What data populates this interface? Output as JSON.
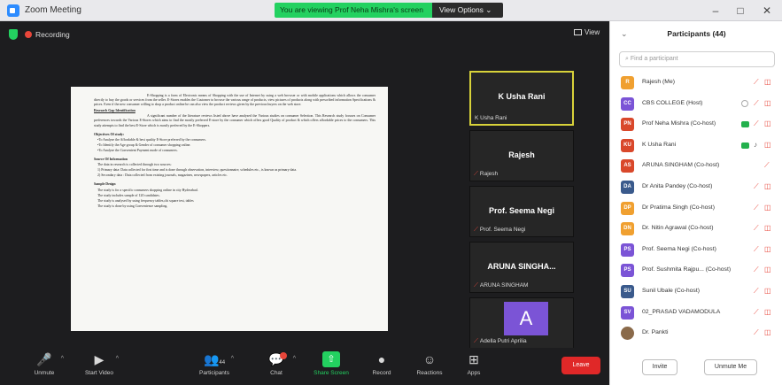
{
  "window": {
    "title": "Zoom Meeting",
    "banner": "You are viewing Prof Neha Mishra's screen",
    "view_options": "View Options ⌄"
  },
  "meeting": {
    "recording_label": "Recording",
    "view_label": "View"
  },
  "document": {
    "intro": "E-Shopping is a form of Electronic means of Shopping with the use of Internet by using a web browser or with mobile applications which allows the consumer directly to buy the goods or services from the seller. E-Stores enables the Customer to browse the various range of products, view pictures of products along with prescribed information Specifications & prices. Even if the new consumer willing to shop a product online he can also view the product reviews given by the previous buyers on the web store.",
    "gap_heading": "Research Gap Identification",
    "gap_text": "A significant number of the literature reviews listed above have analysed the Various studies on consumer Selection. This Research study focuses on Consumer preferences towards the Various E-Stores which aims to find the mostly preferred E-store by the consumer which offers good Quality of product & which offers affordable prices to the consumers. This study attempts to find the best E-Store which is mostly preferred by the E-Shoppers.",
    "objectives_heading": "Objectives Of study:",
    "objectives": [
      "•To Analyze the Affordable & best quality E-Store preferred by the consumers.",
      "•To Identify the Age group & Gender of consumer shopping online.",
      "•To Analyze the Convenient Payment mode of consumers."
    ],
    "source_heading": "Source Of Information",
    "source_intro": "The data in research is collected through two sources:",
    "sources": [
      "1) Primary data: Data collected for first time and is done through observation, interview, questionnaire, schedules etc., is known as primary data.",
      "2) Secondary data : Data collected from existing journals, magazines, newspapers, articles etc."
    ],
    "sample_heading": "Sample Design",
    "sample": [
      "The study is for a specific consumers shopping online in city Hyderabad.",
      "The study includes sample of 120 candidates.",
      "The study is analysed by using frequency tables,chi square test, tables",
      "The study is done by using Convenience sampling."
    ]
  },
  "tiles": [
    {
      "name": "K Usha Rani",
      "label": "K Usha Rani",
      "muted": false,
      "active": true
    },
    {
      "name": "Rajesh",
      "label": "Rajesh",
      "muted": true,
      "active": false
    },
    {
      "name": "Prof. Seema Negi",
      "label": "Prof. Seema Negi",
      "muted": true,
      "active": false
    },
    {
      "name": "ARUNA SINGHA...",
      "label": "ARUNA SINGHAM",
      "muted": true,
      "active": false
    },
    {
      "name": "",
      "avatar_letter": "A",
      "label": "Adella Putri Aprilia",
      "muted": true,
      "active": false
    }
  ],
  "toolbar": {
    "unmute": "Unmute",
    "start_video": "Start Video",
    "participants": "Participants",
    "participants_count": "44",
    "chat": "Chat",
    "share_screen": "Share Screen",
    "record": "Record",
    "reactions": "Reactions",
    "apps": "Apps",
    "leave": "Leave"
  },
  "panel": {
    "title": "Participants (44)",
    "search_placeholder": "Find a participant",
    "participants": [
      {
        "initials": "R",
        "color": "#f0a030",
        "name": "Rajesh (Me)"
      },
      {
        "initials": "CC",
        "color": "#7b54d6",
        "name": "CBS COLLEGE (Host)"
      },
      {
        "initials": "PN",
        "color": "#d9482b",
        "name": "Prof Neha Mishra (Co-host)"
      },
      {
        "initials": "KU",
        "color": "#d9482b",
        "name": "K Usha Rani"
      },
      {
        "initials": "AS",
        "color": "#d9482b",
        "name": "ARUNA SINGHAM (Co-host)"
      },
      {
        "initials": "DA",
        "color": "#3a5a8c",
        "name": "Dr Anita Pandey (Co-host)"
      },
      {
        "initials": "DP",
        "color": "#f0a030",
        "name": "Dr Pratima Singh (Co-host)"
      },
      {
        "initials": "DN",
        "color": "#f0a030",
        "name": "Dr. Nitin Agrawal (Co-host)"
      },
      {
        "initials": "PS",
        "color": "#7b54d6",
        "name": "Prof. Seema Negi (Co-host)"
      },
      {
        "initials": "PS",
        "color": "#7b54d6",
        "name": "Prof. Sushmita Rajpu... (Co-host)"
      },
      {
        "initials": "SU",
        "color": "#3a5a8c",
        "name": "Sunil Ubale (Co-host)"
      },
      {
        "initials": "SV",
        "color": "#7b54d6",
        "name": "02_PRASAD VADAMODULA"
      },
      {
        "initials": "",
        "color": "#8a6a4a",
        "name": "Dr. Pankti"
      }
    ],
    "invite": "Invite",
    "unmute_me": "Unmute Me"
  }
}
